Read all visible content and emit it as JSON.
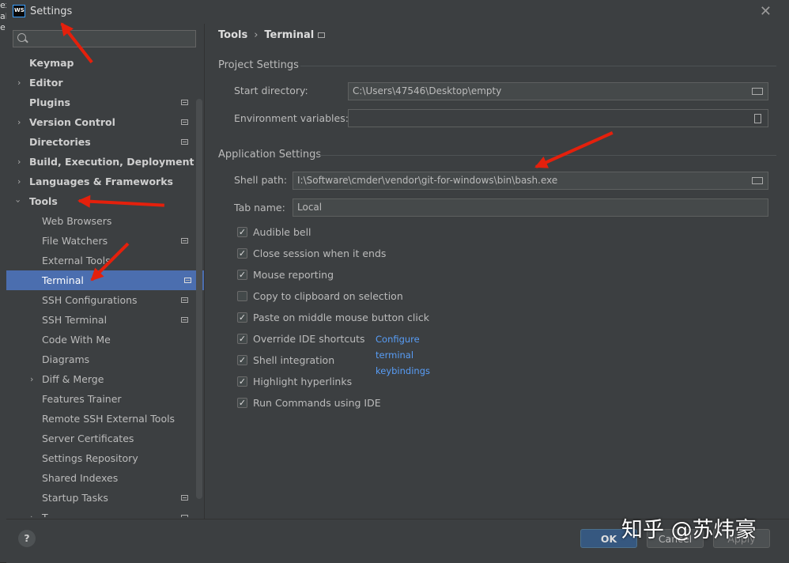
{
  "edge_text": "ex\nal\ne",
  "dialog": {
    "title": "Settings",
    "app_icon_text": "WS"
  },
  "sidebar": {
    "search_placeholder": "",
    "items": [
      {
        "label": "Keymap"
      },
      {
        "label": "Editor"
      },
      {
        "label": "Plugins"
      },
      {
        "label": "Version Control"
      },
      {
        "label": "Directories"
      },
      {
        "label": "Build, Execution, Deployment"
      },
      {
        "label": "Languages & Frameworks"
      },
      {
        "label": "Tools"
      },
      {
        "label": "Web Browsers"
      },
      {
        "label": "File Watchers"
      },
      {
        "label": "External Tools"
      },
      {
        "label": "Terminal"
      },
      {
        "label": "SSH Configurations"
      },
      {
        "label": "SSH Terminal"
      },
      {
        "label": "Code With Me"
      },
      {
        "label": "Diagrams"
      },
      {
        "label": "Diff & Merge"
      },
      {
        "label": "Features Trainer"
      },
      {
        "label": "Remote SSH External Tools"
      },
      {
        "label": "Server Certificates"
      },
      {
        "label": "Settings Repository"
      },
      {
        "label": "Shared Indexes"
      },
      {
        "label": "Startup Tasks"
      },
      {
        "label": "T..."
      }
    ]
  },
  "breadcrumb": {
    "parent": "Tools",
    "separator": "›",
    "current": "Terminal"
  },
  "project_settings": {
    "heading": "Project Settings",
    "start_dir_label": "Start directory:",
    "start_dir_value": "C:\\Users\\47546\\Desktop\\empty",
    "env_label": "Environment variables:",
    "env_value": ""
  },
  "app_settings": {
    "heading": "Application Settings",
    "shell_label": "Shell path:",
    "shell_value": "I:\\Software\\cmder\\vendor\\git-for-windows\\bin\\bash.exe",
    "tab_label": "Tab name:",
    "tab_value": "Local"
  },
  "checkboxes": [
    {
      "label": "Audible bell",
      "checked": true
    },
    {
      "label": "Close session when it ends",
      "checked": true
    },
    {
      "label": "Mouse reporting",
      "checked": true
    },
    {
      "label": "Copy to clipboard on selection",
      "checked": false
    },
    {
      "label": "Paste on middle mouse button click",
      "checked": true
    },
    {
      "label": "Override IDE shortcuts",
      "checked": true
    },
    {
      "label": "Shell integration",
      "checked": true
    },
    {
      "label": "Highlight hyperlinks",
      "checked": true
    },
    {
      "label": "Run Commands using IDE",
      "checked": true
    }
  ],
  "config_link": "Configure terminal keybindings",
  "buttons": {
    "help": "?",
    "ok": "OK",
    "cancel": "Cancel",
    "apply": "Apply"
  },
  "watermark": "知乎 @苏炜豪",
  "colors": {
    "selection": "#4b6eaf",
    "link": "#589df6",
    "arrow": "#e4200c",
    "ok": "#365880"
  }
}
